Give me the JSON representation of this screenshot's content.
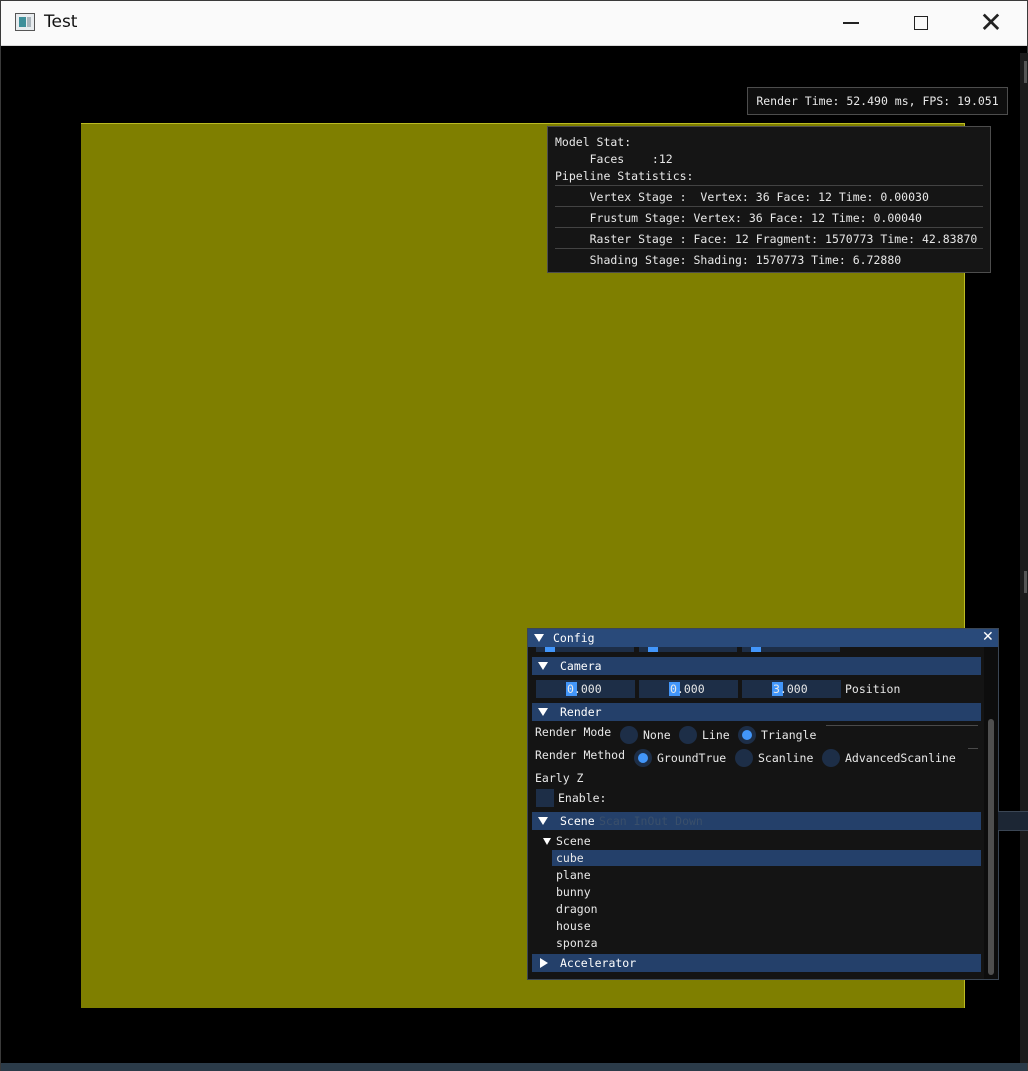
{
  "window": {
    "title": "Test"
  },
  "overlay": {
    "render_time": "Render Time: 52.490 ms, FPS: 19.051"
  },
  "stats": {
    "model_stat": "Model Stat:",
    "faces": "     Faces    :12",
    "pipeline_title": "Pipeline Statistics:",
    "vertex_stage": "     Vertex Stage :  Vertex: 36 Face: 12 Time: 0.00030",
    "frustum_stage": "     Frustum Stage: Vertex: 36 Face: 12 Time: 0.00040",
    "raster_stage": "     Raster Stage : Face: 12 Fragment: 1570773 Time: 42.83870",
    "shading_stage": "     Shading Stage: Shading: 1570773 Time: 6.72880"
  },
  "viewport": {
    "fill_color": "#7f7f00"
  },
  "config": {
    "title": "Config",
    "camera": {
      "header": "Camera",
      "x": "0.000",
      "y": "0.000",
      "z": "3.000",
      "position_label": "Position"
    },
    "render": {
      "header": "Render",
      "render_mode_label": "Render Mode",
      "render_mode_options": [
        "None",
        "Line",
        "Triangle"
      ],
      "render_mode_selected": "Triangle",
      "render_method_label": "Render Method",
      "render_method_options": [
        "GroundTrue",
        "Scanline",
        "AdvancedScanline"
      ],
      "render_method_selected": "GroundTrue",
      "early_z_label": "Early Z",
      "enable_label": "Enable:"
    },
    "scene": {
      "header": "Scene",
      "header_hint": "Scan InOut Down",
      "tree_label": "Scene",
      "items": [
        "cube",
        "plane",
        "bunny",
        "dragon",
        "house",
        "sponza"
      ],
      "selected": "cube"
    },
    "accelerator": {
      "header": "Accelerator"
    }
  },
  "colors": {
    "accent": "#4296fa",
    "header": "#24406a",
    "title_bar_active": "#294a7a",
    "frame_bg": "#1d2e47"
  }
}
